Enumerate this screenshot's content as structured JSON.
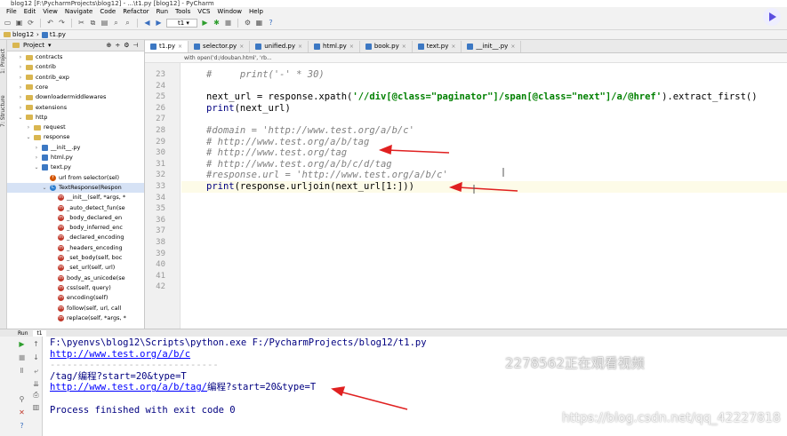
{
  "window": {
    "title": "blog12 [F:\\PycharmProjects\\blog12] - ...\\t1.py [blog12] - PyCharm"
  },
  "menu": [
    "File",
    "Edit",
    "View",
    "Navigate",
    "Code",
    "Refactor",
    "Run",
    "Tools",
    "VCS",
    "Window",
    "Help"
  ],
  "toolbar": {
    "run_config": "t1"
  },
  "navbar": {
    "project": "blog12",
    "file": "t1.py"
  },
  "project_panel": {
    "title": "Project",
    "items": [
      {
        "label": "contracts",
        "type": "folder",
        "depth": 2,
        "arrow": "›"
      },
      {
        "label": "contrib",
        "type": "folder",
        "depth": 2,
        "arrow": "›"
      },
      {
        "label": "contrib_exp",
        "type": "folder",
        "depth": 2,
        "arrow": "›"
      },
      {
        "label": "core",
        "type": "folder",
        "depth": 2,
        "arrow": "›"
      },
      {
        "label": "downloadermiddlewares",
        "type": "folder",
        "depth": 2,
        "arrow": "›"
      },
      {
        "label": "extensions",
        "type": "folder",
        "depth": 2,
        "arrow": "›"
      },
      {
        "label": "http",
        "type": "folder",
        "depth": 2,
        "arrow": "⌄"
      },
      {
        "label": "request",
        "type": "folder",
        "depth": 3,
        "arrow": "›"
      },
      {
        "label": "response",
        "type": "folder",
        "depth": 3,
        "arrow": "⌄"
      },
      {
        "label": "__init__.py",
        "type": "py",
        "depth": 4,
        "arrow": "›"
      },
      {
        "label": "html.py",
        "type": "py",
        "depth": 4,
        "arrow": "›"
      },
      {
        "label": "text.py",
        "type": "py",
        "depth": 4,
        "arrow": "⌄"
      },
      {
        "label": "url from selector(sel)",
        "type": "f",
        "depth": 5,
        "arrow": ""
      },
      {
        "label": "TextResponse(Respon",
        "type": "c",
        "depth": 5,
        "arrow": "⌄",
        "selected": true
      },
      {
        "label": "__init__(self, *args, *",
        "type": "m",
        "depth": 6,
        "arrow": ""
      },
      {
        "label": "_auto_detect_fun(se",
        "type": "m",
        "depth": 6,
        "arrow": ""
      },
      {
        "label": "_body_declared_en",
        "type": "m",
        "depth": 6,
        "arrow": ""
      },
      {
        "label": "_body_inferred_enc",
        "type": "m",
        "depth": 6,
        "arrow": ""
      },
      {
        "label": "_declared_encoding",
        "type": "m",
        "depth": 6,
        "arrow": ""
      },
      {
        "label": "_headers_encoding",
        "type": "m",
        "depth": 6,
        "arrow": ""
      },
      {
        "label": "_set_body(self, boc",
        "type": "m",
        "depth": 6,
        "arrow": ""
      },
      {
        "label": "_set_url(self, url)",
        "type": "m",
        "depth": 6,
        "arrow": ""
      },
      {
        "label": "body_as_unicode(se",
        "type": "m",
        "depth": 6,
        "arrow": ""
      },
      {
        "label": "css(self, query)",
        "type": "m",
        "depth": 6,
        "arrow": ""
      },
      {
        "label": "encoding(self)",
        "type": "m",
        "depth": 6,
        "arrow": ""
      },
      {
        "label": "follow(self, url, call",
        "type": "m",
        "depth": 6,
        "arrow": ""
      },
      {
        "label": "replace(self, *args, *",
        "type": "m",
        "depth": 6,
        "arrow": ""
      }
    ]
  },
  "editor_tabs": [
    "t1.py",
    "selector.py",
    "unified.py",
    "html.py",
    "book.py",
    "text.py",
    "__init__.py"
  ],
  "breadcrumb": "with open('d:/douban.html', 'rb...",
  "editor": {
    "first_line": 23,
    "last_line": 42,
    "lines": [
      {
        "n": 23,
        "text": "#     print('-' * 30)",
        "kind": "cmt"
      },
      {
        "n": 24,
        "text": "",
        "kind": "plain"
      },
      {
        "n": 25,
        "text": "next_url = response.xpath('//div[@class=\"paginator\"]/span[@class=\"next\"]/a/@href').extract_first()",
        "kind": "xpath"
      },
      {
        "n": 26,
        "text": "print(next_url)",
        "kind": "print"
      },
      {
        "n": 27,
        "text": "",
        "kind": "plain"
      },
      {
        "n": 28,
        "text": "#domain = 'http://www.test.org/a/b/c'",
        "kind": "cmt"
      },
      {
        "n": 29,
        "text": "# http://www.test.org/a/b/tag",
        "kind": "cmt"
      },
      {
        "n": 30,
        "text": "# http://www.test.org/tag",
        "kind": "cmt"
      },
      {
        "n": 31,
        "text": "# http://www.test.org/a/b/c/d/tag",
        "kind": "cmt"
      },
      {
        "n": 32,
        "text": "#response.url = 'http://www.test.org/a/b/c'",
        "kind": "cmt"
      },
      {
        "n": 33,
        "text": "print(response.urljoin(next_url[1:]))",
        "kind": "print",
        "current": true
      },
      {
        "n": 34,
        "text": "",
        "kind": "plain"
      },
      {
        "n": 35,
        "text": "",
        "kind": "plain"
      },
      {
        "n": 36,
        "text": "",
        "kind": "plain"
      },
      {
        "n": 37,
        "text": "",
        "kind": "plain"
      },
      {
        "n": 38,
        "text": "",
        "kind": "plain"
      },
      {
        "n": 39,
        "text": "",
        "kind": "plain"
      },
      {
        "n": 40,
        "text": "",
        "kind": "plain"
      },
      {
        "n": 41,
        "text": "",
        "kind": "plain"
      },
      {
        "n": 42,
        "text": "",
        "kind": "plain"
      }
    ]
  },
  "run_panel": {
    "title": "Run",
    "tab": "t1",
    "output": [
      {
        "text": "F:\\pyenvs\\blog12\\Scripts\\python.exe F:/PycharmProjects/blog12/t1.py",
        "kind": "plain"
      },
      {
        "text": "http://www.test.org/a/b/c",
        "kind": "link"
      },
      {
        "text": "------------------------------",
        "kind": "sep"
      },
      {
        "text": "/tag/编程?start=20&type=T",
        "kind": "plain"
      },
      {
        "text": "http://www.test.org/a/b/tag/编程?start=20&type=T",
        "kind": "linkmix",
        "link": "http://www.test.org/a/b/tag/",
        "rest": "编程?start=20&type=T"
      },
      {
        "text": "",
        "kind": "plain"
      },
      {
        "text": "Process finished with exit code 0",
        "kind": "plain"
      }
    ]
  },
  "overlay": {
    "viewer_notice": "2278562正在观看视频",
    "watermark": "https://blog.csdn.net/qq_42227818"
  },
  "colors": {
    "comment": "#808080",
    "string": "#008000",
    "link": "#0000ff",
    "console": "#000080",
    "annotation_arrow": "#e02020"
  }
}
